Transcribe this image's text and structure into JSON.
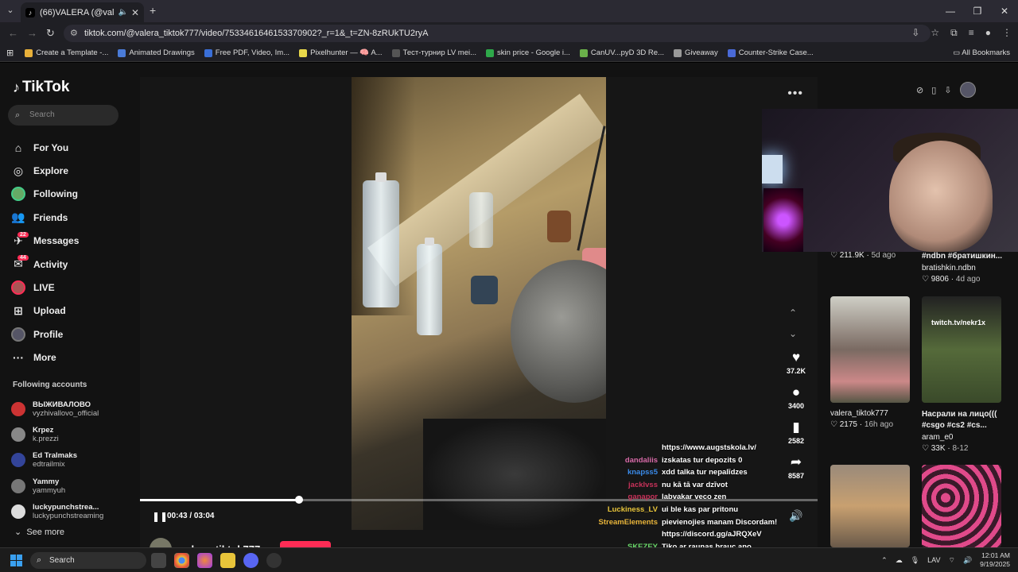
{
  "browser": {
    "tab_title": "(66)VALERA (@valera_tiktok",
    "url": "tiktok.com/@valera_tiktok777/video/7533461646153370902?_r=1&_t=ZN-8zRUkTU2ryA",
    "bookmarks": [
      {
        "label": "Create a Template -...",
        "color": "#e8b03a"
      },
      {
        "label": "Animated Drawings",
        "color": "#4a7bd8"
      },
      {
        "label": "Free PDF, Video, Im...",
        "color": "#3a6fd8"
      },
      {
        "label": "Pixelhunter — 🧠 A...",
        "color": "#e8d84a"
      },
      {
        "label": "Тест-турнир LV mei...",
        "color": "#555"
      },
      {
        "label": "skin price - Google i...",
        "color": "#2ea84a"
      },
      {
        "label": "CanUV...pyD 3D Re...",
        "color": "#6ab04a"
      },
      {
        "label": "Giveaway",
        "color": "#999"
      },
      {
        "label": "Counter-Strike Case...",
        "color": "#4a6ad8"
      }
    ],
    "all_bookmarks": "All Bookmarks"
  },
  "sidebar": {
    "logo": "TikTok",
    "search_placeholder": "Search",
    "nav": [
      {
        "label": "For You",
        "icon": "home-icon",
        "glyph": "⌂"
      },
      {
        "label": "Explore",
        "icon": "compass-icon",
        "glyph": "◎"
      },
      {
        "label": "Following",
        "icon": "avatar",
        "glyph": ""
      },
      {
        "label": "Friends",
        "icon": "friends-icon",
        "glyph": "👥"
      },
      {
        "label": "Messages",
        "icon": "paper-plane-icon",
        "glyph": "✈",
        "badge": "22"
      },
      {
        "label": "Activity",
        "icon": "inbox-icon",
        "glyph": "✉",
        "badge": "44"
      },
      {
        "label": "LIVE",
        "icon": "live-avatar",
        "glyph": "●"
      },
      {
        "label": "Upload",
        "icon": "upload-icon",
        "glyph": "⊞"
      },
      {
        "label": "Profile",
        "icon": "profile-avatar",
        "glyph": "●"
      },
      {
        "label": "More",
        "icon": "more-icon",
        "glyph": "···"
      }
    ],
    "following_title": "Following accounts",
    "following": [
      {
        "name": "ВЫЖИВАЛОВО",
        "user": "vyzhivallovo_official",
        "color": "#c33"
      },
      {
        "name": "Krpez",
        "user": "k.prezzi",
        "color": "#888"
      },
      {
        "name": "Ed Tralmaks",
        "user": "edtrailmix",
        "color": "#349"
      },
      {
        "name": "Yammy",
        "user": "yammyuh",
        "color": "#777"
      },
      {
        "name": "luckypunchstrea...",
        "user": "luckypunchstreaming",
        "color": "#ddd"
      }
    ],
    "see_more": "See more"
  },
  "player": {
    "time": "00:43 / 03:04",
    "progress": 0.235,
    "author": "valera_tiktok777",
    "actions": [
      {
        "icon": "heart-icon",
        "glyph": "♥",
        "count": "37.2K"
      },
      {
        "icon": "comment-icon",
        "glyph": "●",
        "count": "3400"
      },
      {
        "icon": "bookmark-icon",
        "glyph": "▮",
        "count": "2582"
      },
      {
        "icon": "share-icon",
        "glyph": "➦",
        "count": "8587"
      }
    ]
  },
  "chat": [
    {
      "user": "",
      "msg": "https://www.augstskola.lv/",
      "color": "#fff"
    },
    {
      "user": "dandaliis",
      "msg": "izskatas tur depozits 0",
      "color": "#d86aa8"
    },
    {
      "user": "knapss5",
      "msg": "xdd talka tur nepalīdzes",
      "color": "#3a8ae8"
    },
    {
      "user": "jacklvss",
      "msg": "nu kā tā var dzīvot",
      "color": "#c8325a"
    },
    {
      "user": "ganapor",
      "msg": "labvakar veco zen",
      "color": "#c8325a"
    },
    {
      "user": "Luckiness_LV",
      "msg": "ui ble kas par pritonu",
      "color": "#e8c43a"
    },
    {
      "user": "StreamElements",
      "msg": "pievienojies manam Discordam!",
      "color": "#e8b43a"
    },
    {
      "user": "",
      "msg": "https://discord.gg/aJRQXeV",
      "color": "#fff"
    },
    {
      "user": "SKEZEY",
      "msg": "Tiko ar rauņas brauc ano",
      "color": "#6ad86a"
    },
    {
      "user": "SassyStar",
      "msg": "gandrīz kā xuc savi talka",
      "color": "#e8b43a"
    }
  ],
  "right_panel": {
    "tiles": [
      {
        "title": "",
        "likes": "211.9K",
        "age": "5d ago",
        "author": ""
      },
      {
        "title": "#ndbn #братишкин...",
        "likes": "9806",
        "age": "4d ago",
        "author": "bratishkin.ndbn"
      },
      {
        "title": "",
        "likes": "2175",
        "age": "16h ago",
        "author": "valera_tiktok777"
      },
      {
        "title": "Насрали на лицо((( #csgo #cs2 #cs...",
        "likes": "33K",
        "age": "8-12",
        "author": "aram_e0",
        "overlay": "twitch.tv/nekr1x"
      }
    ]
  },
  "taskbar": {
    "search": "Search",
    "lang": "LAV",
    "time": "12:01 AM",
    "date": "9/19/2025"
  }
}
